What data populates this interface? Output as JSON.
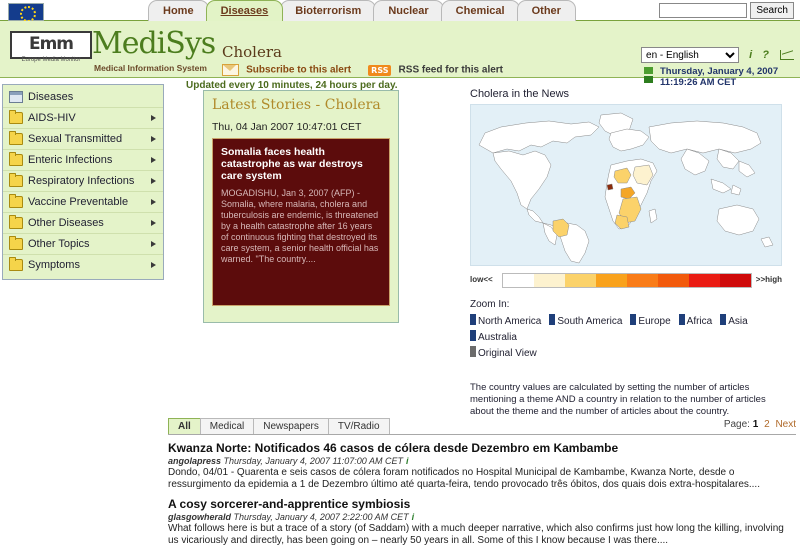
{
  "topbar": {
    "tabs": [
      {
        "label": "Home",
        "active": false
      },
      {
        "label": "Diseases",
        "active": true
      },
      {
        "label": "Bioterrorism",
        "active": false
      },
      {
        "label": "Nuclear",
        "active": false
      },
      {
        "label": "Chemical",
        "active": false
      },
      {
        "label": "Other",
        "active": false
      }
    ],
    "search_value": "",
    "search_placeholder": "",
    "search_button": "Search"
  },
  "header": {
    "logo_text": "Emm",
    "logo_sub": "Europe Media Monitor",
    "product": "MediSys",
    "product_sub": "Medical Information System",
    "alert_title": "Cholera",
    "subscribe_label": "Subscribe to this alert",
    "rss_badge": "RSS",
    "rss_label": "RSS feed for this alert",
    "updated": "Updated every 10 minutes, 24 hours per day.",
    "language_selected": "en - English",
    "language_options": [
      "en - English"
    ],
    "info_icon": "i",
    "help_icon": "?",
    "date_line1": "Thursday, January 4, 2007",
    "date_line2": "11:19:26 AM CET"
  },
  "sidebar": {
    "items": [
      {
        "label": "Diseases",
        "icon": "window-icon",
        "arrow": false
      },
      {
        "label": "AIDS-HIV",
        "icon": "folder-icon",
        "arrow": true
      },
      {
        "label": "Sexual Transmitted",
        "icon": "folder-icon",
        "arrow": true
      },
      {
        "label": "Enteric Infections",
        "icon": "folder-icon",
        "arrow": true
      },
      {
        "label": "Respiratory Infections",
        "icon": "folder-icon",
        "arrow": true
      },
      {
        "label": "Vaccine Preventable",
        "icon": "folder-icon",
        "arrow": true
      },
      {
        "label": "Other Diseases",
        "icon": "folder-icon",
        "arrow": true
      },
      {
        "label": "Other Topics",
        "icon": "folder-icon",
        "arrow": true
      },
      {
        "label": "Symptoms",
        "icon": "folder-icon",
        "arrow": true
      }
    ]
  },
  "stories": {
    "title": "Latest Stories - Cholera",
    "date": "Thu, 04 Jan 2007 10:47:01 CET",
    "headline": "Somalia faces health catastrophe as war destroys care system",
    "body": "MOGADISHU, Jan 3, 2007 (AFP) - Somalia, where malaria, cholera and tuberculosis are endemic, is threatened by a health catastrophe after 16 years of continuous fighting that destroyed its care system, a senior health official has warned. \"The country...."
  },
  "map": {
    "title": "Cholera in the News",
    "legend_low": "low<<",
    "legend_high": ">>high",
    "legend_colors": [
      "#ffffff",
      "#fdf2cf",
      "#fbd26a",
      "#f9a21c",
      "#f97c18",
      "#f25a0c",
      "#ea1c13",
      "#cf0a0a"
    ],
    "zoom_label": "Zoom In:",
    "zoom_links": [
      {
        "label": "North America",
        "color": "blue"
      },
      {
        "label": "South America",
        "color": "blue"
      },
      {
        "label": "Europe",
        "color": "blue"
      },
      {
        "label": "Africa",
        "color": "blue"
      },
      {
        "label": "Asia",
        "color": "blue"
      },
      {
        "label": "Australia",
        "color": "blue"
      },
      {
        "label": "Original View",
        "color": "grey"
      }
    ],
    "note": "The country values are calculated by setting the number of articles mentioning a theme AND a country in relation to the number of articles about the theme and the number of articles about the country."
  },
  "news": {
    "tabs": [
      {
        "label": "All",
        "active": true
      },
      {
        "label": "Medical",
        "active": false
      },
      {
        "label": "Newspapers",
        "active": false
      },
      {
        "label": "TV/Radio",
        "active": false
      }
    ],
    "page_label": "Page:",
    "page_current": "1",
    "page_next_num": "2",
    "page_next": "Next",
    "articles": [
      {
        "title": "Kwanza Norte: Notificados 46 casos de cólera desde Dezembro em Kambambe",
        "source": "angolapress",
        "date": "Thursday, January 4, 2007 11:07:00 AM CET",
        "info": "i",
        "text": "Dondo, 04/01 - Quarenta e seis casos de cólera foram notificados no Hospital Municipal de Kambambe, Kwanza Norte, desde o ressurgimento da epidemia a 1 de Dezembro último até quarta-feira, tendo provocado três óbitos, dos quais dois extra-hospitalares...."
      },
      {
        "title": "A cosy sorcerer-and-apprentice symbiosis",
        "source": "glasgowherald",
        "date": "Thursday, January 4, 2007 2:22:00 AM CET",
        "info": "i",
        "text": "What follows here is but a trace of a story (of Saddam) with a much deeper narrative, which also confirms just how long the killing, involving us vicariously and directly, has been going on – nearly 50 years in all. Some of this I know because I was there...."
      }
    ]
  }
}
